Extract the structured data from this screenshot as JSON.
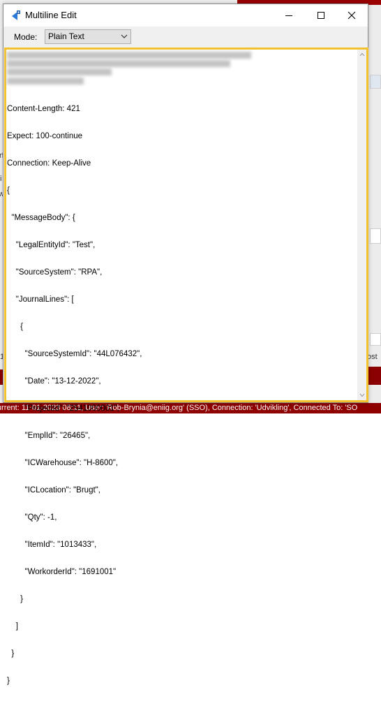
{
  "window": {
    "title": "Multiline Edit",
    "controls": {
      "minimize": "minimize",
      "maximize": "maximize",
      "close": "close"
    }
  },
  "mode": {
    "label": "Mode:",
    "selected": "Plain Text"
  },
  "editor": {
    "lines": [
      "Content-Length: 421",
      "Expect: 100-continue",
      "Connection: Keep-Alive",
      "{",
      "  \"MessageBody\": {",
      "    \"LegalEntityId\": \"Test\",",
      "    \"SourceSystem\": \"RPA\",",
      "    \"JournalLines\": [",
      "      {",
      "        \"SourceSystemId\": \"44L076432\",",
      "        \"Date\": \"13-12-2022\",",
      "        \"ProjectId\": \"2541000001\",",
      "        \"EmplId\": \"26465\",",
      "        \"ICWarehouse\": \"H-8600\",",
      "        \"ICLocation\": \"Brugt\",",
      "        \"Qty\": -1,",
      "        \"ItemId\": \"1013433\",",
      "        \"WorkorderId\": \"1691001\"",
      "      }",
      "    ]",
      "  }",
      "}"
    ]
  },
  "background": {
    "status_text": "urrent: 11-01-2023 08:11, User: 'Rob-Brynia@eniig.org' (SSO), Connection: 'Udvikling', Connected To: 'SO",
    "right_fragment": "ost",
    "left_fragments": [
      "rf",
      "i",
      "w",
      "1"
    ]
  },
  "colors": {
    "editor_border": "#f2c12e",
    "status_bar": "#8f0000"
  }
}
